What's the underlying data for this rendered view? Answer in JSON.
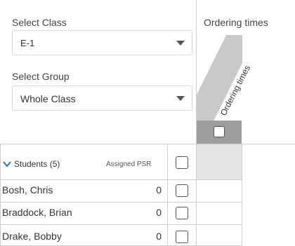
{
  "class_selector": {
    "label": "Select Class",
    "value": "E-1",
    "dropdown_icon": "caret-down-icon"
  },
  "group_selector": {
    "label": "Select Group",
    "value": "Whole Class",
    "dropdown_icon": "caret-down-icon"
  },
  "column": {
    "header": "Ordering times",
    "rotated_label": "Ordering times"
  },
  "students_header": {
    "toggle_icon": "chevron-down-icon",
    "label": "Students (5)",
    "psr_label": "Assigned PSR"
  },
  "students": [
    {
      "name": "Bosh, Chris",
      "psr": "0"
    },
    {
      "name": "Braddock, Brian",
      "psr": "0"
    },
    {
      "name": "Drake, Bobby",
      "psr": "0"
    }
  ],
  "colors": {
    "accent": "#2a6fd6",
    "banner": "#c9c9c9",
    "column_bar": "#9e9e9e",
    "header_cell": "#e4e4e4"
  }
}
